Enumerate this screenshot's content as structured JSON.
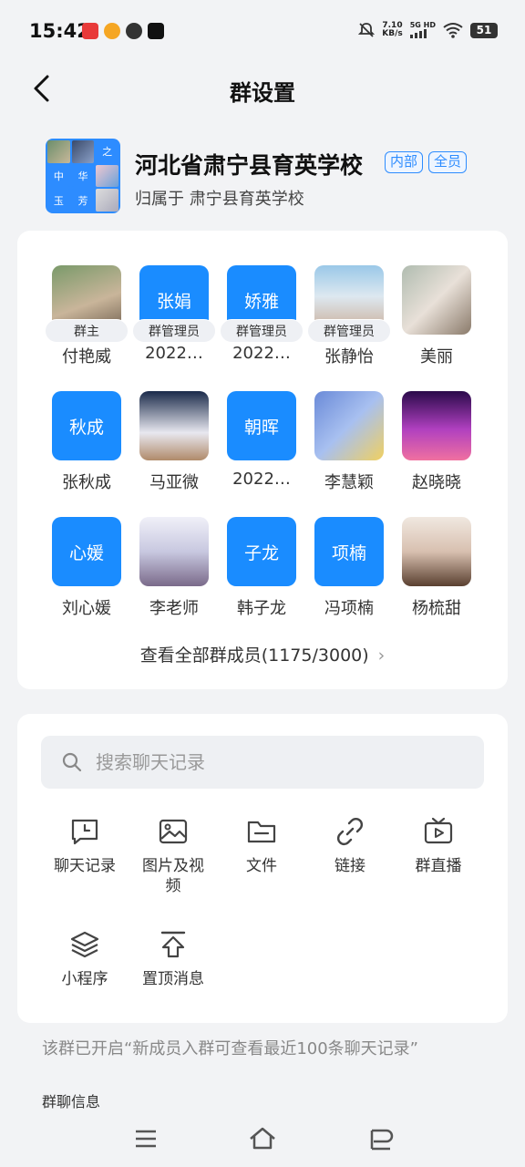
{
  "status_bar": {
    "time": "15:42",
    "net_speed_value": "7.10",
    "net_speed_unit": "KB/s",
    "signal_label": "5G HD",
    "battery": "51",
    "icons": [
      "netease-music-icon",
      "weibo-icon",
      "message-icon",
      "tiktok-icon",
      "mute-bell-icon",
      "signal-icon",
      "wifi-icon",
      "battery-icon"
    ]
  },
  "header": {
    "title": "群设置",
    "back_icon": "chevron-left-icon"
  },
  "group": {
    "name": "河北省肃宁县育英学校",
    "tags": [
      "内部",
      "全员"
    ],
    "belong_prefix": "归属于",
    "belong_org": "肃宁县育英学校",
    "avatar_chars": [
      "之",
      "中",
      "华",
      "玉",
      "芳"
    ]
  },
  "members": [
    {
      "name": "付艳威",
      "role": "群主",
      "avatar_type": "photo",
      "avatar_text": ""
    },
    {
      "name": "2022…",
      "role": "群管理员",
      "avatar_type": "text",
      "avatar_text": "张娟"
    },
    {
      "name": "2022…",
      "role": "群管理员",
      "avatar_type": "text",
      "avatar_text": "娇雅"
    },
    {
      "name": "张静怡",
      "role": "群管理员",
      "avatar_type": "photo",
      "avatar_text": ""
    },
    {
      "name": "美丽",
      "role": "",
      "avatar_type": "photo",
      "avatar_text": ""
    },
    {
      "name": "张秋成",
      "role": "",
      "avatar_type": "text",
      "avatar_text": "秋成"
    },
    {
      "name": "马亚微",
      "role": "",
      "avatar_type": "photo",
      "avatar_text": ""
    },
    {
      "name": "2022…",
      "role": "",
      "avatar_type": "text",
      "avatar_text": "朝晖"
    },
    {
      "name": "李慧颖",
      "role": "",
      "avatar_type": "photo",
      "avatar_text": ""
    },
    {
      "name": "赵晓晓",
      "role": "",
      "avatar_type": "photo",
      "avatar_text": ""
    },
    {
      "name": "刘心媛",
      "role": "",
      "avatar_type": "text",
      "avatar_text": "心媛"
    },
    {
      "name": "李老师",
      "role": "",
      "avatar_type": "photo",
      "avatar_text": ""
    },
    {
      "name": "韩子龙",
      "role": "",
      "avatar_type": "text",
      "avatar_text": "子龙"
    },
    {
      "name": "冯项楠",
      "role": "",
      "avatar_type": "text",
      "avatar_text": "项楠"
    },
    {
      "name": "杨梳甜",
      "role": "",
      "avatar_type": "photo",
      "avatar_text": ""
    }
  ],
  "view_all": {
    "label": "查看全部群成员(1175/3000)"
  },
  "search": {
    "placeholder": "搜索聊天记录",
    "value": ""
  },
  "tools": [
    {
      "label": "聊天记录",
      "icon": "chat-history-icon"
    },
    {
      "label": "图片及视频",
      "icon": "image-icon"
    },
    {
      "label": "文件",
      "icon": "folder-icon"
    },
    {
      "label": "链接",
      "icon": "link-icon"
    },
    {
      "label": "群直播",
      "icon": "live-tv-icon"
    },
    {
      "label": "小程序",
      "icon": "layers-icon"
    },
    {
      "label": "置顶消息",
      "icon": "pin-top-icon"
    }
  ],
  "notice": "该群已开启“新成员入群可查看最近100条聊天记录”",
  "section_label": "群聊信息",
  "navbar": {
    "icons": [
      "menu-icon",
      "home-icon",
      "back-nav-icon"
    ]
  },
  "colors": {
    "accent": "#1a8cff",
    "background": "#f2f3f5",
    "card": "#ffffff"
  }
}
